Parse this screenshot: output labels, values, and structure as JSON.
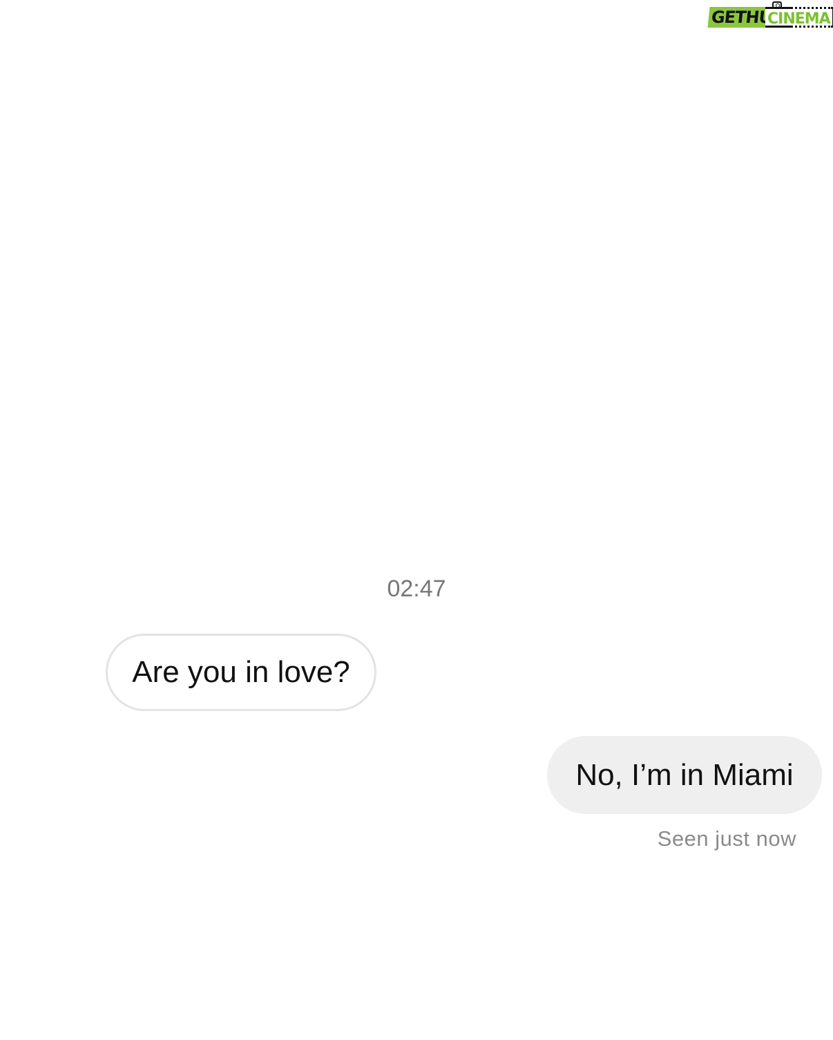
{
  "watermark": {
    "part1": "GETHU",
    "part2": "CINEMA",
    "colors": {
      "green": "#8cc63f",
      "black": "#111111"
    }
  },
  "conversation": {
    "timestamp": "02:47",
    "messages": [
      {
        "direction": "incoming",
        "text": "Are you in love?"
      },
      {
        "direction": "outgoing",
        "text": "No, I’m in Miami"
      }
    ],
    "read_receipt": "Seen just now"
  },
  "colors": {
    "background": "#ffffff",
    "incoming_border": "#e3e3e3",
    "outgoing_fill": "#efefef",
    "meta_text": "#777777"
  }
}
